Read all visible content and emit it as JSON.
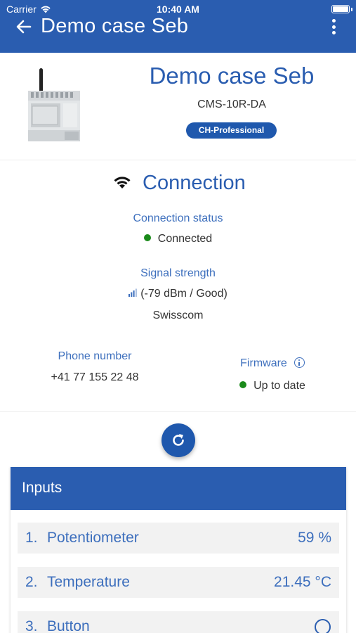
{
  "status_bar": {
    "carrier": "Carrier",
    "time": "10:40 AM"
  },
  "header": {
    "title": "Demo case Seb"
  },
  "device": {
    "name": "Demo case Seb",
    "model": "CMS-10R-DA",
    "badge": "CH-Professional"
  },
  "connection": {
    "title": "Connection",
    "status_label": "Connection status",
    "status_value": "Connected",
    "signal_label": "Signal strength",
    "signal_value": "(-79 dBm / Good)",
    "provider": "Swisscom",
    "phone_label": "Phone number",
    "phone_value": "+41 77 155 22 48",
    "firmware_label": "Firmware",
    "firmware_value": "Up to date"
  },
  "inputs": {
    "title": "Inputs",
    "items": [
      {
        "num": "1.",
        "name": "Potentiometer",
        "value": "59 %"
      },
      {
        "num": "2.",
        "name": "Temperature",
        "value": "21.45 °C"
      },
      {
        "num": "3.",
        "name": "Button",
        "value": ""
      }
    ]
  },
  "colors": {
    "primary": "#2a5db0",
    "accent_text": "#3d6fbd",
    "status_green": "#1a8a1a"
  }
}
